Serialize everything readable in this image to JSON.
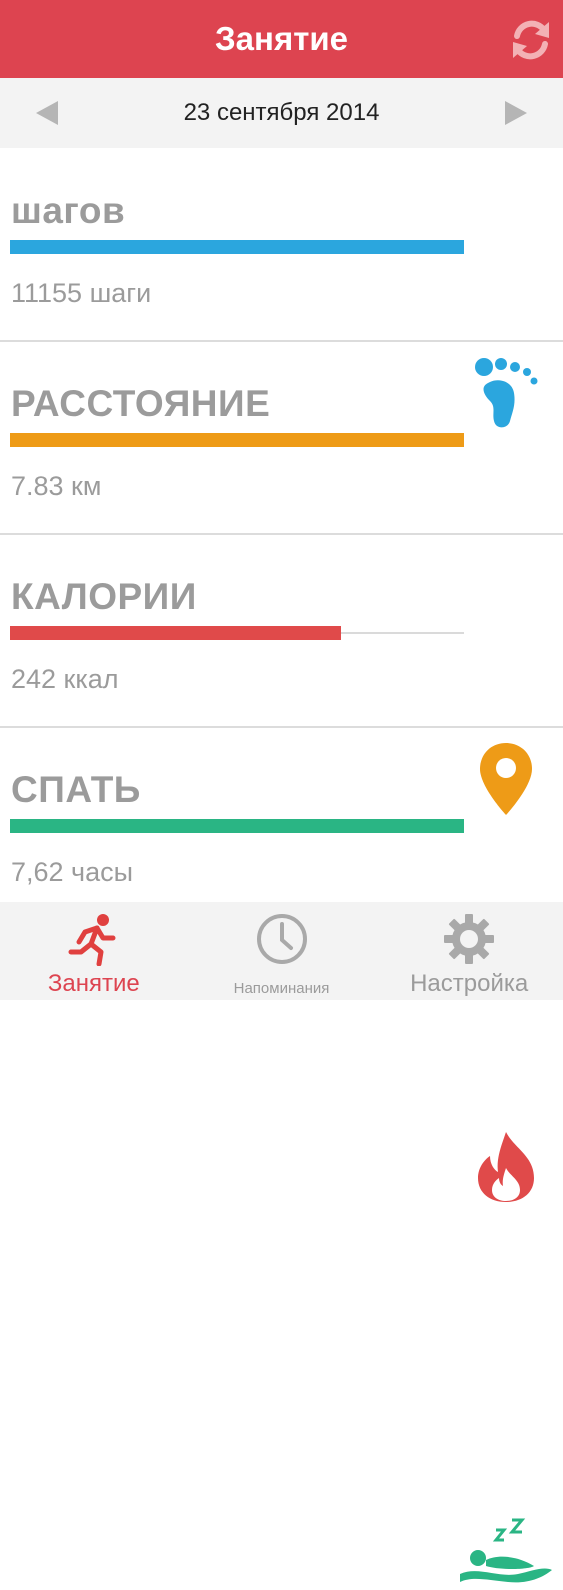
{
  "header": {
    "title": "Занятие"
  },
  "date_bar": {
    "date": "23 сентября 2014"
  },
  "metrics": [
    {
      "title": "шагов",
      "value": "11155 шаги",
      "progress": 1.0,
      "color": "#2ba6de",
      "icon": "footprint-icon"
    },
    {
      "title": "РАССТОЯНИЕ",
      "value": "7.83 км",
      "progress": 1.0,
      "color": "#ee9b17",
      "icon": "location-pin-icon"
    },
    {
      "title": "КАЛОРИИ",
      "value": "242 ккал",
      "progress": 0.73,
      "color": "#e04a4a",
      "icon": "flame-icon"
    },
    {
      "title": "СПАТЬ",
      "value": "7,62 часы",
      "progress": 1.0,
      "color": "#2ab584",
      "icon": "sleep-icon"
    }
  ],
  "bottom_nav": [
    {
      "label": "Занятие",
      "active": true,
      "icon": "running-person-icon"
    },
    {
      "label": "Напоминания",
      "active": false,
      "icon": "clock-icon"
    },
    {
      "label": "Настройка",
      "active": false,
      "icon": "gear-icon"
    }
  ],
  "colors": {
    "accent": "#dd4450",
    "muted": "#9b9b9b"
  }
}
